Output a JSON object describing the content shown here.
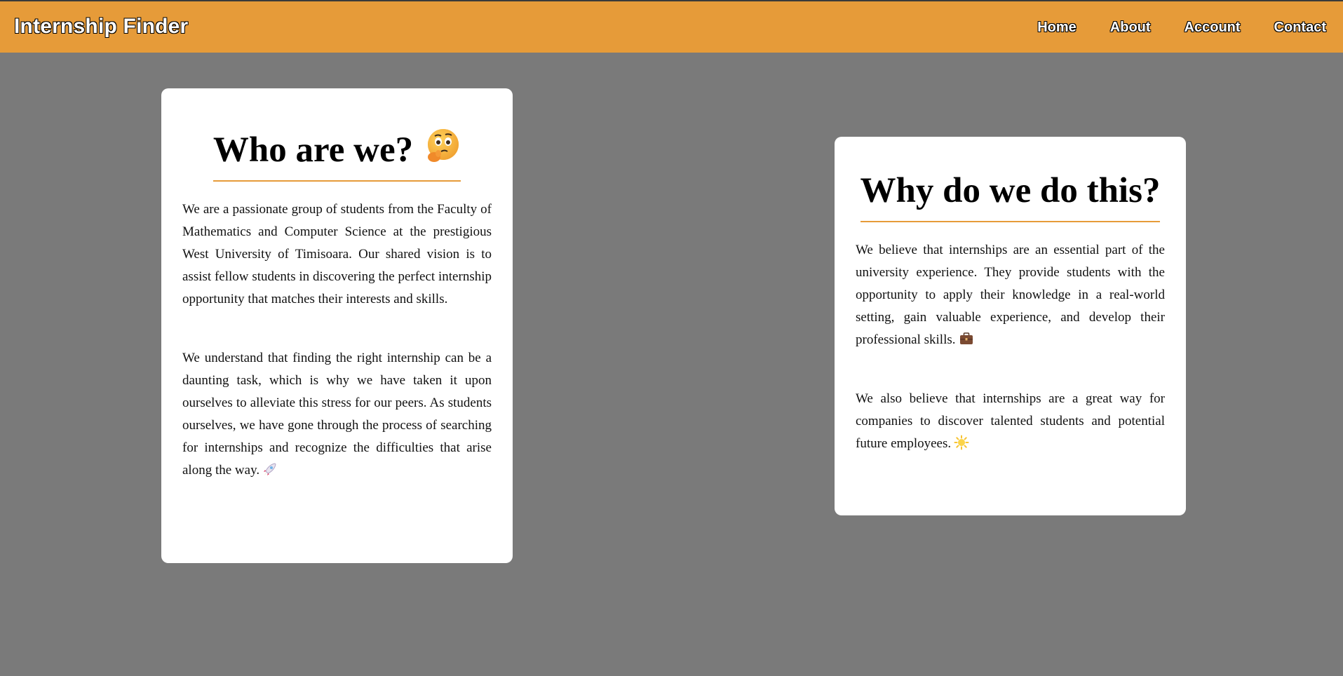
{
  "header": {
    "brand": "Internship Finder",
    "nav": [
      {
        "label": "Home"
      },
      {
        "label": "About"
      },
      {
        "label": "Account"
      },
      {
        "label": "Contact"
      }
    ]
  },
  "who": {
    "title": "Who are we?",
    "title_emoji": "thinking-face-icon",
    "paragraph1": "We are a passionate group of students from the Faculty of Mathematics and Computer Science at the prestigious West University of Timisoara. Our shared vision is to assist fellow students in discovering the perfect internship opportunity that matches their interests and skills.",
    "paragraph2": "We understand that finding the right internship can be a daunting task, which is why we have taken it upon ourselves to alleviate this stress for our peers. As students ourselves, we have gone through the process of searching for internships and recognize the difficulties that arise along the way.",
    "paragraph2_emoji": "rocket-icon"
  },
  "why": {
    "title": "Why do we do this?",
    "paragraph1": "We believe that internships are an essential part of the university experience. They provide students with the opportunity to apply their knowledge in a real-world setting, gain valuable experience, and develop their professional skills.",
    "paragraph1_emoji": "briefcase-icon",
    "paragraph2": "We also believe that internships are a great way for companies to discover talented students and potential future employees.",
    "paragraph2_emoji": "sun-icon"
  },
  "colors": {
    "header_bg": "#e69b39",
    "page_bg": "#7a7a7a",
    "card_bg": "#ffffff",
    "accent": "#e69b39"
  }
}
